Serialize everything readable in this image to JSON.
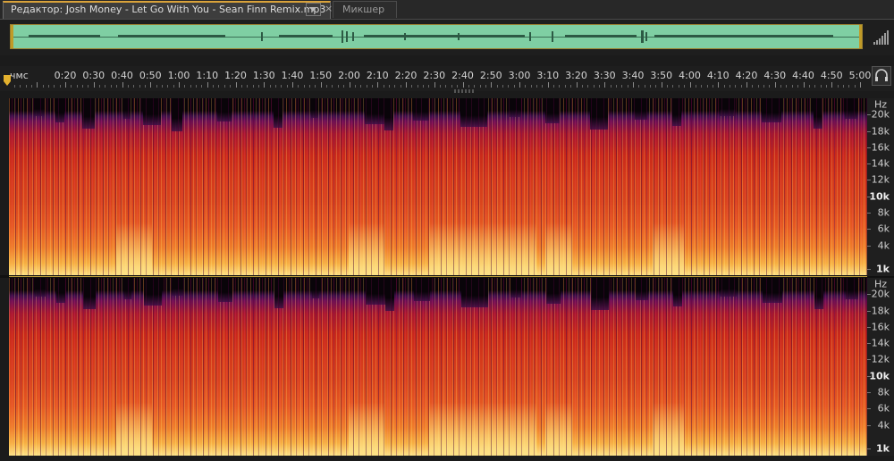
{
  "tabs": {
    "editor_label": "Редактор: Josh Money - Let Go With You - Sean Finn Remix.mp3",
    "close_glyph": "×",
    "mixer_label": "Микшер"
  },
  "timeline": {
    "unit": "чмс",
    "labels": [
      "0:20",
      "0:30",
      "0:40",
      "0:50",
      "1:00",
      "1:10",
      "1:20",
      "1:30",
      "1:40",
      "1:50",
      "2:00",
      "2:10",
      "2:20",
      "2:30",
      "2:40",
      "2:50",
      "3:00",
      "3:10",
      "3:20",
      "3:30",
      "3:40",
      "3:50",
      "4:00",
      "4:10",
      "4:20",
      "4:30",
      "4:40",
      "4:50",
      "5:00"
    ]
  },
  "freq_ruler": {
    "unit": "Hz",
    "labels": [
      "20k",
      "18k",
      "16k",
      "14k",
      "12k",
      "10k",
      "8k",
      "6k",
      "4k",
      "1k"
    ]
  },
  "colors": {
    "overview_green": "#7fcfa3",
    "accent_gold": "#c09b28"
  },
  "icons": [
    "zoom-level-icon",
    "headphones-icon",
    "playhead-marker-icon",
    "dropdown-icon",
    "close-icon"
  ]
}
